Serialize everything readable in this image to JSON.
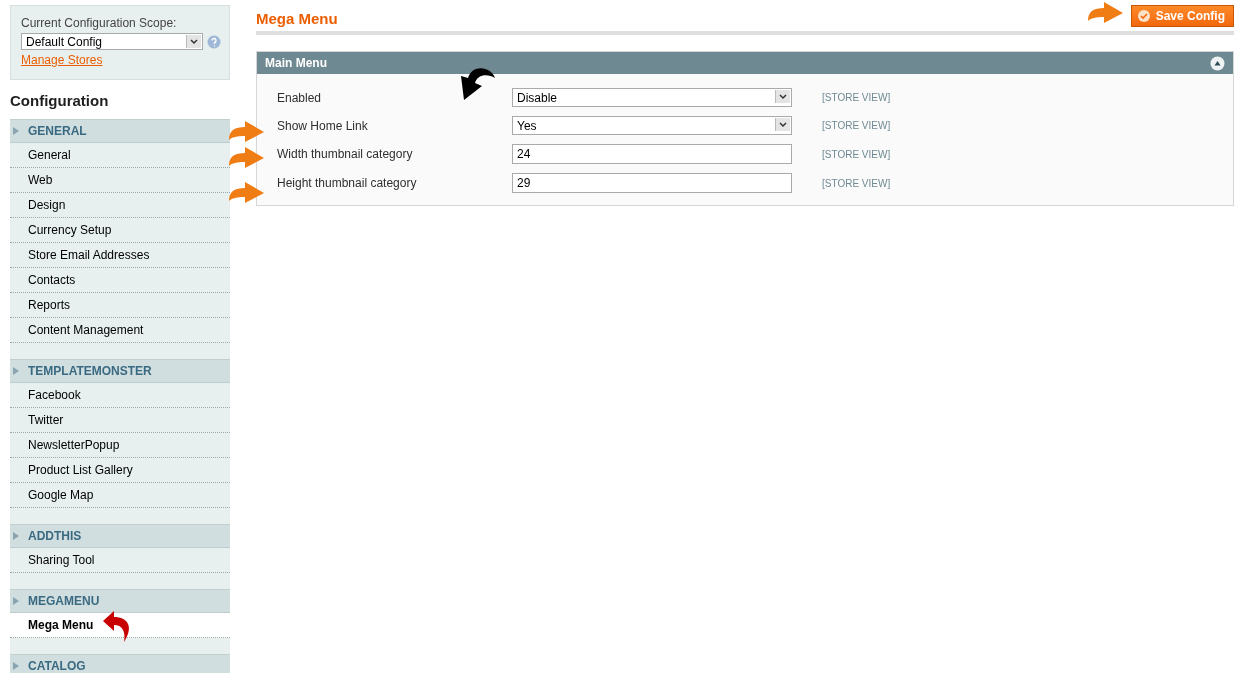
{
  "scope": {
    "label": "Current Configuration Scope:",
    "value": "Default Config",
    "link": "Manage Stores"
  },
  "sidebar": {
    "title": "Configuration",
    "sections": [
      {
        "title": "GENERAL",
        "items": [
          {
            "label": "General",
            "selected": false
          },
          {
            "label": "Web",
            "selected": false
          },
          {
            "label": "Design",
            "selected": false
          },
          {
            "label": "Currency Setup",
            "selected": false
          },
          {
            "label": "Store Email Addresses",
            "selected": false
          },
          {
            "label": "Contacts",
            "selected": false
          },
          {
            "label": "Reports",
            "selected": false
          },
          {
            "label": "Content Management",
            "selected": false
          }
        ]
      },
      {
        "title": "TEMPLATEMONSTER",
        "items": [
          {
            "label": "Facebook",
            "selected": false
          },
          {
            "label": "Twitter",
            "selected": false
          },
          {
            "label": "NewsletterPopup",
            "selected": false
          },
          {
            "label": "Product List Gallery",
            "selected": false
          },
          {
            "label": "Google Map",
            "selected": false
          }
        ]
      },
      {
        "title": "ADDTHIS",
        "items": [
          {
            "label": "Sharing Tool",
            "selected": false
          }
        ]
      },
      {
        "title": "MEGAMENU",
        "items": [
          {
            "label": "Mega Menu",
            "selected": true
          }
        ]
      },
      {
        "title": "CATALOG"
      }
    ]
  },
  "page": {
    "title": "Mega Menu",
    "save_button": "Save Config"
  },
  "panel": {
    "title": "Main Menu",
    "expanded": true,
    "fields": [
      {
        "label": "Enabled",
        "kind": "select",
        "value": "Disable",
        "scope": "[STORE VIEW]"
      },
      {
        "label": "Show Home Link",
        "kind": "select",
        "value": "Yes",
        "scope": "[STORE VIEW]"
      },
      {
        "label": "Width thumbnail category",
        "kind": "text",
        "value": "24",
        "scope": "[STORE VIEW]"
      },
      {
        "label": "Height thumbnail category",
        "kind": "text",
        "value": "29",
        "scope": "[STORE VIEW]"
      }
    ]
  }
}
